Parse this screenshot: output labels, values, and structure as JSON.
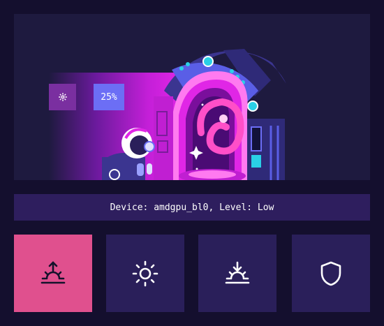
{
  "banner": {
    "percent_label": "25%",
    "settings_icon": "gear-icon"
  },
  "status": {
    "text": "Device: amdgpu_bl0, Level: Low"
  },
  "tiles": [
    {
      "icon": "sunrise-icon",
      "active": true
    },
    {
      "icon": "sun-icon",
      "active": false
    },
    {
      "icon": "sunset-icon",
      "active": false
    },
    {
      "icon": "shield-icon",
      "active": false
    }
  ],
  "colors": {
    "background": "#140f2e",
    "panel": "#1e1a3f",
    "status_bar": "#2e1e5e",
    "tile": "#2a1f5a",
    "tile_active": "#e0508e",
    "chip_settings": "#7a2fa0",
    "chip_percent": "#6c6ef5",
    "accent_magenta": "#e026e6"
  }
}
